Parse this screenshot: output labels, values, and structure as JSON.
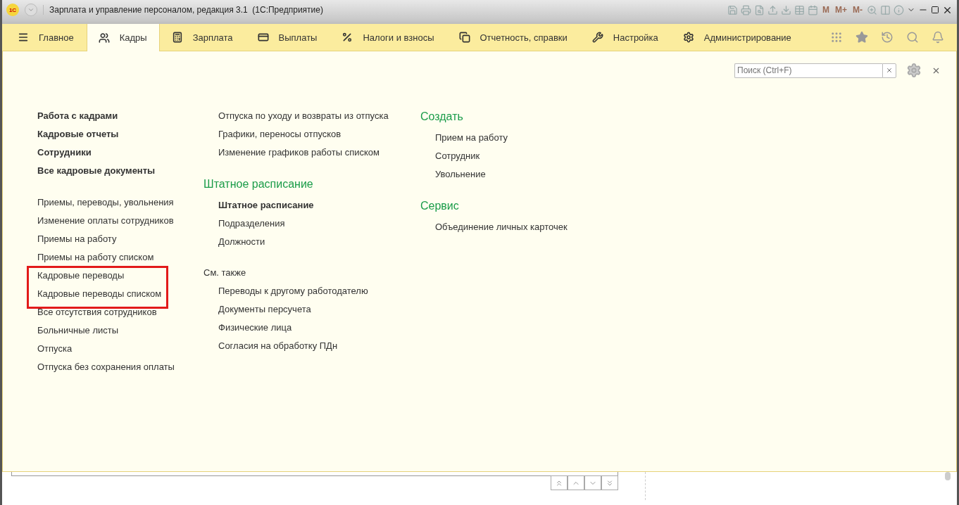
{
  "window": {
    "title": "Зарплата и управление персоналом, редакция 3.1  (1С:Предприятие)",
    "logo": "1С",
    "memory_buttons": [
      "M",
      "M+",
      "M-"
    ]
  },
  "sections_menu": [
    {
      "label": "Главное",
      "selected": false
    },
    {
      "label": "Кадры",
      "selected": true
    },
    {
      "label": "Зарплата",
      "selected": false
    },
    {
      "label": "Выплаты",
      "selected": false
    },
    {
      "label": "Налоги и взносы",
      "selected": false
    },
    {
      "label": "Отчетность, справки",
      "selected": false
    },
    {
      "label": "Настройка",
      "selected": false
    },
    {
      "label": "Администрирование",
      "selected": false
    }
  ],
  "search": {
    "placeholder": "Поиск (Ctrl+F)"
  },
  "columns": [
    {
      "sections": [
        {
          "items": [
            {
              "label": "Работа с кадрами",
              "bold": true,
              "framed": false
            },
            {
              "label": "Кадровые отчеты",
              "bold": true,
              "framed": false
            },
            {
              "label": "Сотрудники",
              "bold": true,
              "framed": false
            },
            {
              "label": "Все кадровые документы",
              "bold": true,
              "framed": false
            }
          ]
        },
        {
          "items": [
            {
              "label": "Приемы, переводы, увольнения",
              "bold": false,
              "framed": false
            },
            {
              "label": "Изменение оплаты сотрудников",
              "bold": false,
              "framed": false
            },
            {
              "label": "Приемы на работу",
              "bold": false,
              "framed": false
            },
            {
              "label": "Приемы на работу списком",
              "bold": false,
              "framed": false
            },
            {
              "label": "Кадровые переводы",
              "bold": false,
              "framed": true
            },
            {
              "label": "Кадровые переводы списком",
              "bold": false,
              "framed": true
            },
            {
              "label": "Все отсутствия сотрудников",
              "bold": false,
              "framed": false
            },
            {
              "label": "Больничные листы",
              "bold": false,
              "framed": false
            },
            {
              "label": "Отпуска",
              "bold": false,
              "framed": false
            },
            {
              "label": "Отпуска без сохранения оплаты",
              "bold": false,
              "framed": false
            }
          ]
        }
      ]
    },
    {
      "sections": [
        {
          "items": [
            {
              "label": "Отпуска по уходу и возвраты из отпуска",
              "bold": false,
              "framed": false
            },
            {
              "label": "Графики, переносы отпусков",
              "bold": false,
              "framed": false
            },
            {
              "label": "Изменение графиков работы списком",
              "bold": false,
              "framed": false
            }
          ]
        },
        {
          "heading": "Штатное расписание",
          "kind": "group",
          "items": [
            {
              "label": "Штатное расписание",
              "bold": true,
              "framed": false
            },
            {
              "label": "Подразделения",
              "bold": false,
              "framed": false
            },
            {
              "label": "Должности",
              "bold": false,
              "framed": false
            }
          ]
        },
        {
          "heading": "См. также",
          "kind": "see_also",
          "items": [
            {
              "label": "Переводы к другому работодателю",
              "bold": false,
              "framed": false
            },
            {
              "label": "Документы персучета",
              "bold": false,
              "framed": false
            },
            {
              "label": "Физические лица",
              "bold": false,
              "framed": false
            },
            {
              "label": "Согласия на обработку ПДн",
              "bold": false,
              "framed": false
            }
          ]
        }
      ]
    },
    {
      "sections": [
        {
          "heading": "Создать",
          "kind": "group",
          "items": [
            {
              "label": "Прием на работу",
              "bold": false,
              "framed": false
            },
            {
              "label": "Сотрудник",
              "bold": false,
              "framed": false
            },
            {
              "label": "Увольнение",
              "bold": false,
              "framed": false
            }
          ]
        },
        {
          "heading": "Сервис",
          "kind": "group",
          "items": [
            {
              "label": "Объединение личных карточек",
              "bold": false,
              "framed": false
            }
          ]
        }
      ]
    }
  ]
}
